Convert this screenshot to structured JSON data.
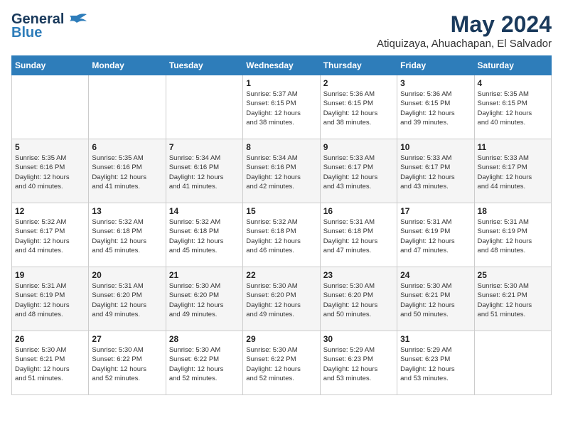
{
  "logo": {
    "line1": "General",
    "line2": "Blue"
  },
  "title": "May 2024",
  "subtitle": "Atiquizaya, Ahuachapan, El Salvador",
  "days_of_week": [
    "Sunday",
    "Monday",
    "Tuesday",
    "Wednesday",
    "Thursday",
    "Friday",
    "Saturday"
  ],
  "weeks": [
    [
      {
        "day": "",
        "info": ""
      },
      {
        "day": "",
        "info": ""
      },
      {
        "day": "",
        "info": ""
      },
      {
        "day": "1",
        "info": "Sunrise: 5:37 AM\nSunset: 6:15 PM\nDaylight: 12 hours\nand 38 minutes."
      },
      {
        "day": "2",
        "info": "Sunrise: 5:36 AM\nSunset: 6:15 PM\nDaylight: 12 hours\nand 38 minutes."
      },
      {
        "day": "3",
        "info": "Sunrise: 5:36 AM\nSunset: 6:15 PM\nDaylight: 12 hours\nand 39 minutes."
      },
      {
        "day": "4",
        "info": "Sunrise: 5:35 AM\nSunset: 6:15 PM\nDaylight: 12 hours\nand 40 minutes."
      }
    ],
    [
      {
        "day": "5",
        "info": "Sunrise: 5:35 AM\nSunset: 6:16 PM\nDaylight: 12 hours\nand 40 minutes."
      },
      {
        "day": "6",
        "info": "Sunrise: 5:35 AM\nSunset: 6:16 PM\nDaylight: 12 hours\nand 41 minutes."
      },
      {
        "day": "7",
        "info": "Sunrise: 5:34 AM\nSunset: 6:16 PM\nDaylight: 12 hours\nand 41 minutes."
      },
      {
        "day": "8",
        "info": "Sunrise: 5:34 AM\nSunset: 6:16 PM\nDaylight: 12 hours\nand 42 minutes."
      },
      {
        "day": "9",
        "info": "Sunrise: 5:33 AM\nSunset: 6:17 PM\nDaylight: 12 hours\nand 43 minutes."
      },
      {
        "day": "10",
        "info": "Sunrise: 5:33 AM\nSunset: 6:17 PM\nDaylight: 12 hours\nand 43 minutes."
      },
      {
        "day": "11",
        "info": "Sunrise: 5:33 AM\nSunset: 6:17 PM\nDaylight: 12 hours\nand 44 minutes."
      }
    ],
    [
      {
        "day": "12",
        "info": "Sunrise: 5:32 AM\nSunset: 6:17 PM\nDaylight: 12 hours\nand 44 minutes."
      },
      {
        "day": "13",
        "info": "Sunrise: 5:32 AM\nSunset: 6:18 PM\nDaylight: 12 hours\nand 45 minutes."
      },
      {
        "day": "14",
        "info": "Sunrise: 5:32 AM\nSunset: 6:18 PM\nDaylight: 12 hours\nand 45 minutes."
      },
      {
        "day": "15",
        "info": "Sunrise: 5:32 AM\nSunset: 6:18 PM\nDaylight: 12 hours\nand 46 minutes."
      },
      {
        "day": "16",
        "info": "Sunrise: 5:31 AM\nSunset: 6:18 PM\nDaylight: 12 hours\nand 47 minutes."
      },
      {
        "day": "17",
        "info": "Sunrise: 5:31 AM\nSunset: 6:19 PM\nDaylight: 12 hours\nand 47 minutes."
      },
      {
        "day": "18",
        "info": "Sunrise: 5:31 AM\nSunset: 6:19 PM\nDaylight: 12 hours\nand 48 minutes."
      }
    ],
    [
      {
        "day": "19",
        "info": "Sunrise: 5:31 AM\nSunset: 6:19 PM\nDaylight: 12 hours\nand 48 minutes."
      },
      {
        "day": "20",
        "info": "Sunrise: 5:31 AM\nSunset: 6:20 PM\nDaylight: 12 hours\nand 49 minutes."
      },
      {
        "day": "21",
        "info": "Sunrise: 5:30 AM\nSunset: 6:20 PM\nDaylight: 12 hours\nand 49 minutes."
      },
      {
        "day": "22",
        "info": "Sunrise: 5:30 AM\nSunset: 6:20 PM\nDaylight: 12 hours\nand 49 minutes."
      },
      {
        "day": "23",
        "info": "Sunrise: 5:30 AM\nSunset: 6:20 PM\nDaylight: 12 hours\nand 50 minutes."
      },
      {
        "day": "24",
        "info": "Sunrise: 5:30 AM\nSunset: 6:21 PM\nDaylight: 12 hours\nand 50 minutes."
      },
      {
        "day": "25",
        "info": "Sunrise: 5:30 AM\nSunset: 6:21 PM\nDaylight: 12 hours\nand 51 minutes."
      }
    ],
    [
      {
        "day": "26",
        "info": "Sunrise: 5:30 AM\nSunset: 6:21 PM\nDaylight: 12 hours\nand 51 minutes."
      },
      {
        "day": "27",
        "info": "Sunrise: 5:30 AM\nSunset: 6:22 PM\nDaylight: 12 hours\nand 52 minutes."
      },
      {
        "day": "28",
        "info": "Sunrise: 5:30 AM\nSunset: 6:22 PM\nDaylight: 12 hours\nand 52 minutes."
      },
      {
        "day": "29",
        "info": "Sunrise: 5:30 AM\nSunset: 6:22 PM\nDaylight: 12 hours\nand 52 minutes."
      },
      {
        "day": "30",
        "info": "Sunrise: 5:29 AM\nSunset: 6:23 PM\nDaylight: 12 hours\nand 53 minutes."
      },
      {
        "day": "31",
        "info": "Sunrise: 5:29 AM\nSunset: 6:23 PM\nDaylight: 12 hours\nand 53 minutes."
      },
      {
        "day": "",
        "info": ""
      }
    ]
  ]
}
